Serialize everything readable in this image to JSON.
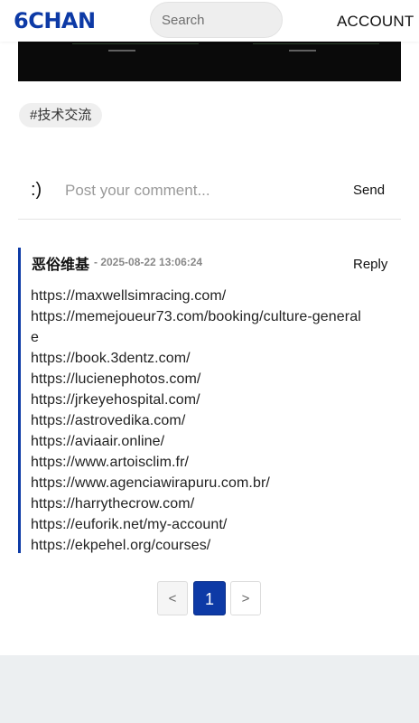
{
  "header": {
    "logo": "6CHAN",
    "search_placeholder": "Search",
    "account_label": "ACCOUNT"
  },
  "post": {
    "tag": "#技术交流"
  },
  "composer": {
    "emoticon": ":)",
    "placeholder": "Post your comment...",
    "send_label": "Send"
  },
  "comment": {
    "author": "恶俗维基",
    "date": "- 2025-08-22 13:06:24",
    "reply_label": "Reply",
    "links": [
      "https://maxwellsimracing.com/",
      "https://memejoueur73.com/booking/culture-generale",
      "https://book.3dentz.com/",
      "https://lucienephotos.com/",
      "https://jrkeyehospital.com/",
      "https://astrovedika.com/",
      "https://aviaair.online/",
      "https://www.artoisclim.fr/",
      "https://www.agenciawirapuru.com.br/",
      "https://harrythecrow.com/",
      "https://euforik.net/my-account/",
      "https://ekpehel.org/courses/"
    ]
  },
  "pagination": {
    "prev": "<",
    "current": "1",
    "next": ">"
  },
  "colors": {
    "brand": "#0d3aa6",
    "page_background": "#eceff1"
  }
}
